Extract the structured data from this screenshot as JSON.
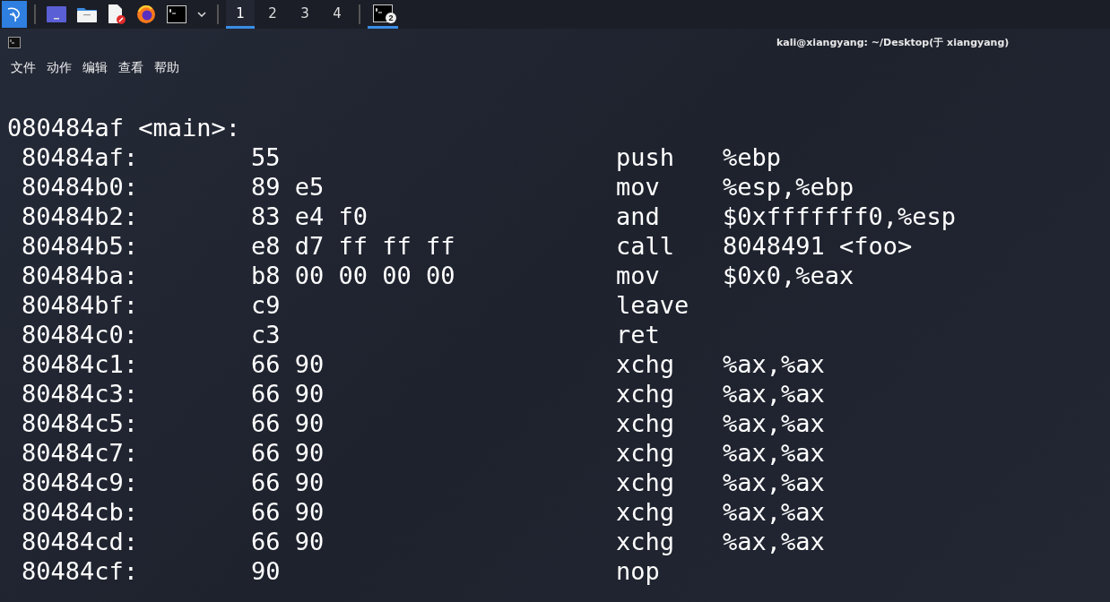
{
  "taskbar": {
    "launchers": [
      {
        "kind": "menu"
      },
      {
        "kind": "desktop"
      },
      {
        "kind": "files"
      },
      {
        "kind": "editor"
      },
      {
        "kind": "browser"
      },
      {
        "kind": "terminal"
      }
    ],
    "workspaces": [
      {
        "label": "1",
        "selected": true
      },
      {
        "label": "2",
        "selected": false
      },
      {
        "label": "3",
        "selected": false
      },
      {
        "label": "4",
        "selected": false
      }
    ],
    "tasks": [
      {
        "badge": "2",
        "selected": true
      }
    ]
  },
  "window": {
    "title": "kali@xiangyang: ~/Desktop(于 xiangyang)"
  },
  "menu": [
    "文件",
    "动作",
    "编辑",
    "查看",
    "帮助"
  ],
  "terminal": {
    "heading": "080484af <main>:",
    "lines": [
      {
        "address": "80484af:",
        "bytes": "55",
        "mnemonic": "push",
        "operands": "%ebp"
      },
      {
        "address": "80484b0:",
        "bytes": "89 e5",
        "mnemonic": "mov",
        "operands": "%esp,%ebp"
      },
      {
        "address": "80484b2:",
        "bytes": "83 e4 f0",
        "mnemonic": "and",
        "operands": "$0xfffffff0,%esp"
      },
      {
        "address": "80484b5:",
        "bytes": "e8 d7 ff ff ff",
        "mnemonic": "call",
        "operands": "8048491 <foo>"
      },
      {
        "address": "80484ba:",
        "bytes": "b8 00 00 00 00",
        "mnemonic": "mov",
        "operands": "$0x0,%eax"
      },
      {
        "address": "80484bf:",
        "bytes": "c9",
        "mnemonic": "leave"
      },
      {
        "address": "80484c0:",
        "bytes": "c3",
        "mnemonic": "ret"
      },
      {
        "address": "80484c1:",
        "bytes": "66 90",
        "mnemonic": "xchg",
        "operands": "%ax,%ax"
      },
      {
        "address": "80484c3:",
        "bytes": "66 90",
        "mnemonic": "xchg",
        "operands": "%ax,%ax"
      },
      {
        "address": "80484c5:",
        "bytes": "66 90",
        "mnemonic": "xchg",
        "operands": "%ax,%ax"
      },
      {
        "address": "80484c7:",
        "bytes": "66 90",
        "mnemonic": "xchg",
        "operands": "%ax,%ax"
      },
      {
        "address": "80484c9:",
        "bytes": "66 90",
        "mnemonic": "xchg",
        "operands": "%ax,%ax"
      },
      {
        "address": "80484cb:",
        "bytes": "66 90",
        "mnemonic": "xchg",
        "operands": "%ax,%ax"
      },
      {
        "address": "80484cd:",
        "bytes": "66 90",
        "mnemonic": "xchg",
        "operands": "%ax,%ax"
      },
      {
        "address": "80484cf:",
        "bytes": "90",
        "mnemonic": "nop"
      }
    ]
  }
}
